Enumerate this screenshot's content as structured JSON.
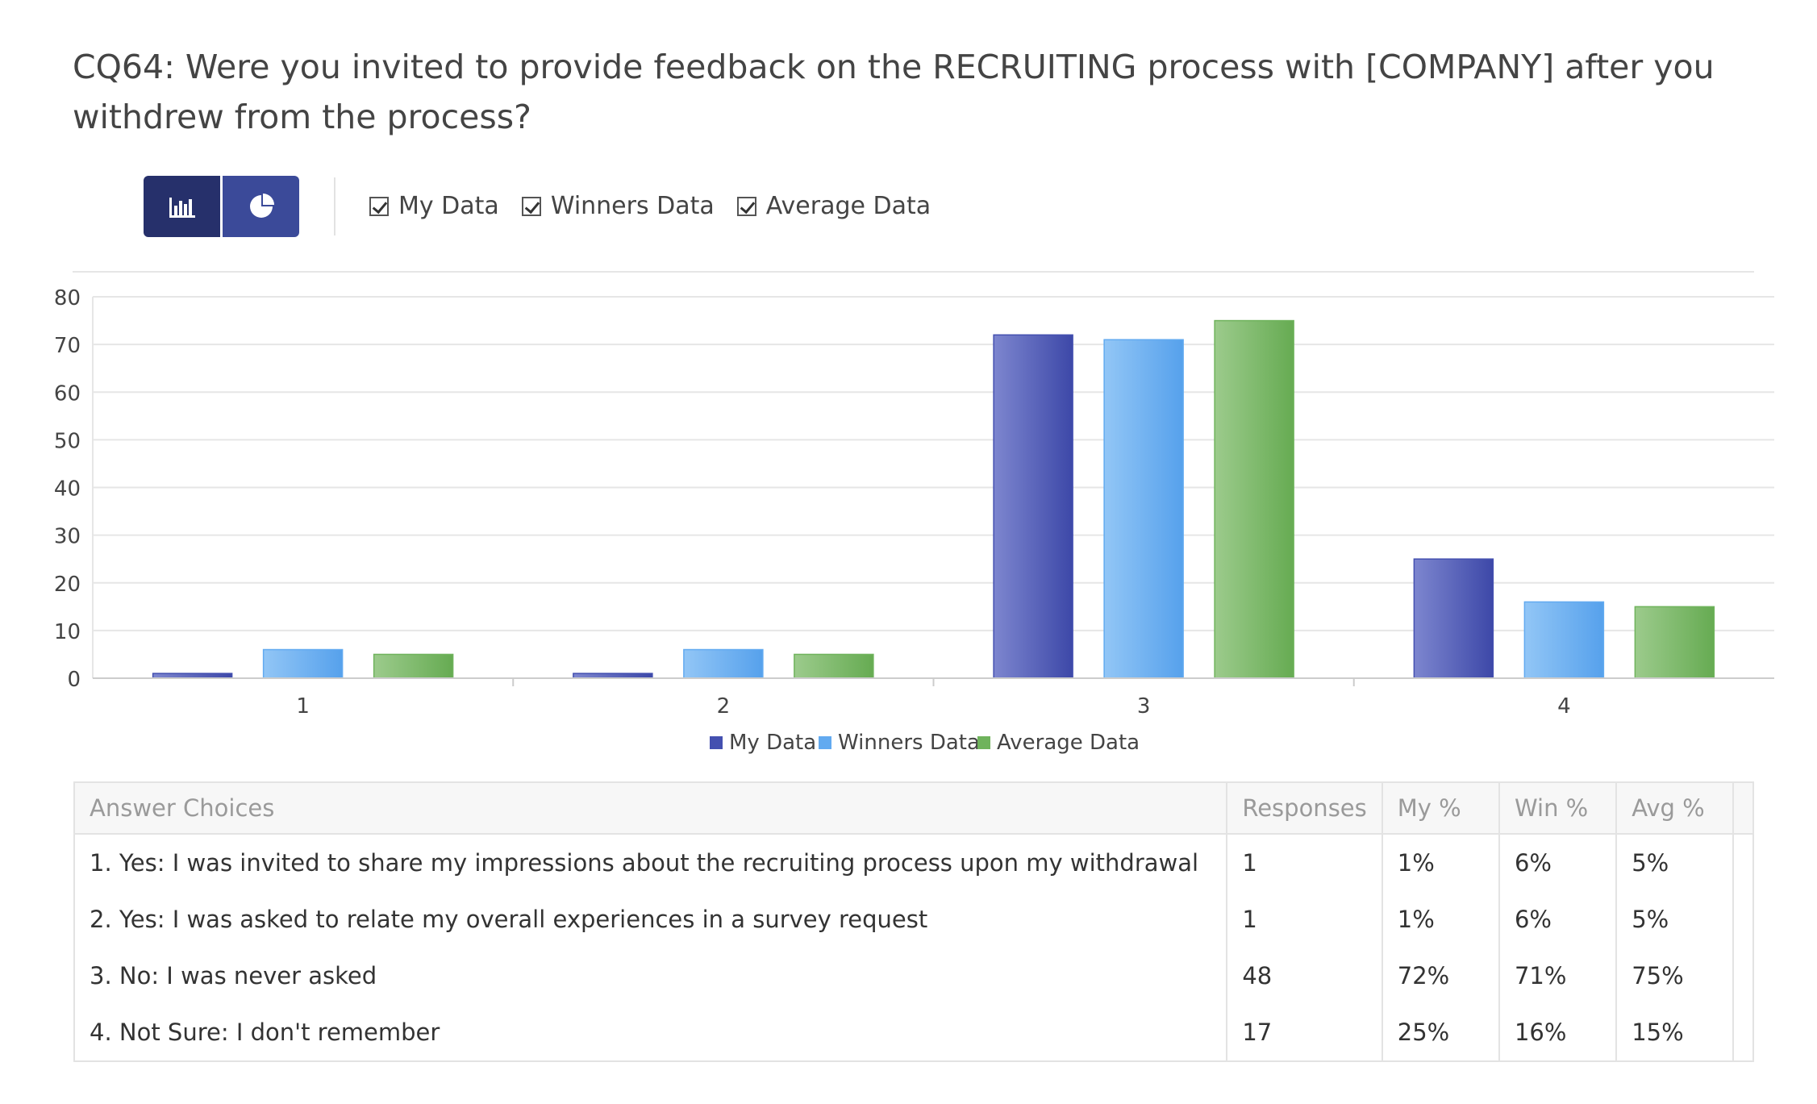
{
  "question": {
    "title": "CQ64: Were you invited to provide feedback on the RECRUITING process with [COMPANY] after you withdrew from the process?"
  },
  "toolbar": {
    "views": [
      {
        "name": "bar-chart-view",
        "icon": "bar-chart-icon",
        "active": true
      },
      {
        "name": "pie-chart-view",
        "icon": "pie-chart-icon",
        "active": false
      }
    ],
    "checkboxes": [
      {
        "label": "My Data",
        "checked": true
      },
      {
        "label": "Winners Data",
        "checked": true
      },
      {
        "label": "Average Data",
        "checked": true
      }
    ]
  },
  "colors": {
    "my_data": "#4450b0",
    "winners_data": "#62aaf0",
    "average_data": "#6fb35c",
    "grid": "#e6e6e6",
    "axis_text": "#444444"
  },
  "chart_data": {
    "type": "bar",
    "categories": [
      "1",
      "2",
      "3",
      "4"
    ],
    "series": [
      {
        "name": "My Data",
        "values": [
          1,
          1,
          72,
          25
        ]
      },
      {
        "name": "Winners Data",
        "values": [
          6,
          6,
          71,
          16
        ]
      },
      {
        "name": "Average Data",
        "values": [
          5,
          5,
          75,
          15
        ]
      }
    ],
    "ylim": [
      0,
      80
    ],
    "yticks": [
      0,
      10,
      20,
      30,
      40,
      50,
      60,
      70,
      80
    ],
    "grid": true,
    "legend": "bottom-center"
  },
  "table": {
    "headers": [
      "Answer Choices",
      "Responses",
      "My %",
      "Win %",
      "Avg %"
    ],
    "rows": [
      [
        "1. Yes: I was invited to share my impressions about the recruiting process upon my withdrawal",
        "1",
        "1%",
        "6%",
        "5%"
      ],
      [
        "2. Yes: I was asked to relate my overall experiences in a survey request",
        "1",
        "1%",
        "6%",
        "5%"
      ],
      [
        "3. No: I was never asked",
        "48",
        "72%",
        "71%",
        "75%"
      ],
      [
        "4. Not Sure: I don't remember",
        "17",
        "25%",
        "16%",
        "15%"
      ]
    ]
  }
}
